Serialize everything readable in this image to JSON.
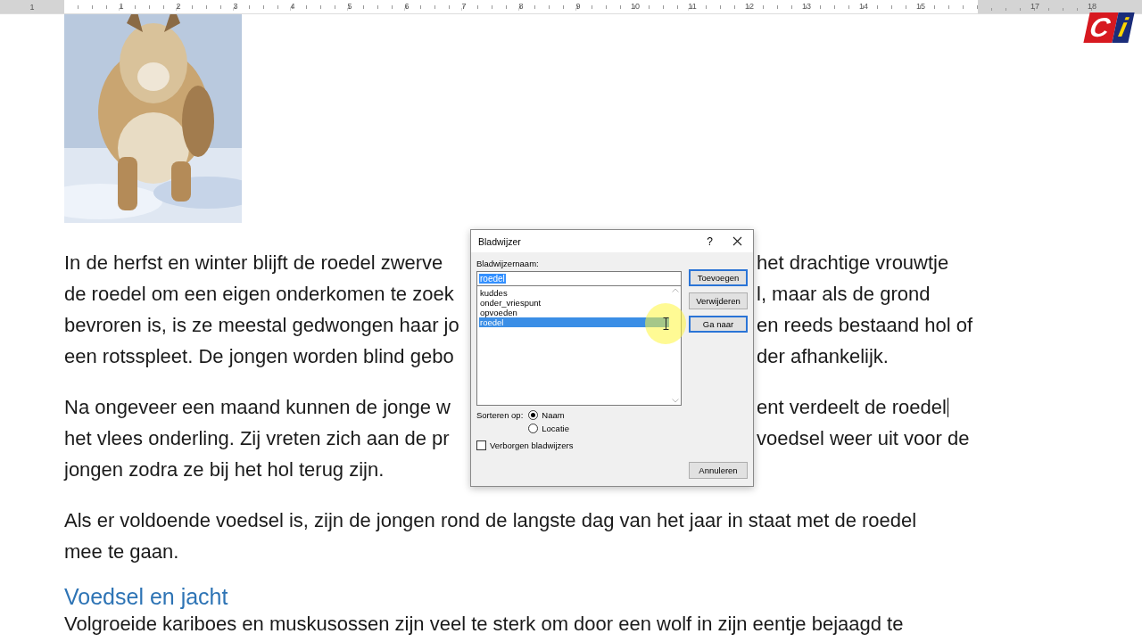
{
  "ruler": {
    "left_labels": [
      "1"
    ],
    "labels": [
      "1",
      "2",
      "3",
      "4",
      "5",
      "6",
      "7",
      "8",
      "9",
      "10",
      "11",
      "12",
      "13",
      "14",
      "15"
    ],
    "right_labels": [
      "17",
      "18"
    ]
  },
  "logo": {
    "letters": [
      "C",
      "i"
    ]
  },
  "paragraphs": [
    {
      "lines": [
        {
          "left": "In de herfst en winter blijft de roedel zwerve",
          "right": "het drachtige vrouwtje"
        },
        {
          "left": "de roedel om een eigen onderkomen te zoek",
          "right": "l, maar als de grond"
        },
        {
          "left": "bevroren is, is ze meestal gedwongen haar jo",
          "right": "en reeds bestaand hol of"
        },
        {
          "left": "een rotsspleet. De jongen worden blind gebo",
          "right": "der afhankelijk."
        }
      ]
    },
    {
      "lines": [
        {
          "left": "Na ongeveer een maand kunnen de jonge w",
          "right": "ent verdeelt de roedel",
          "caret": true
        },
        {
          "left": "het vlees onderling. Zij vreten zich aan de pr",
          "right": "voedsel weer uit voor de"
        },
        {
          "left": "jongen zodra ze bij het hol terug zijn."
        }
      ]
    },
    {
      "lines": [
        {
          "left": "Als er voldoende voedsel is, zijn de jongen rond de langste dag van het jaar in staat met de roedel"
        },
        {
          "left": "mee te gaan."
        }
      ]
    }
  ],
  "heading": "Voedsel en jacht",
  "last_line": "Volgroeide kariboes en muskusossen zijn veel te sterk om door een wolf in zijn eentje bejaagd te",
  "dialog": {
    "title": "Bladwijzer",
    "help": "?",
    "name_label": "Bladwijzernaam:",
    "name_value": "roedel",
    "items": [
      {
        "label": "kuddes",
        "selected": false
      },
      {
        "label": "onder_vriespunt",
        "selected": false
      },
      {
        "label": "opvoeden",
        "selected": false
      },
      {
        "label": "roedel",
        "selected": true
      }
    ],
    "buttons": [
      {
        "label": "Toevoegen",
        "focused": true
      },
      {
        "label": "Verwijderen",
        "focused": false
      },
      {
        "label": "Ga naar",
        "focused": true
      }
    ],
    "sort_label": "Sorteren op:",
    "sort_options": [
      {
        "label": "Naam",
        "selected": true
      },
      {
        "label": "Locatie",
        "selected": false
      }
    ],
    "hidden": {
      "label": "Verborgen bladwijzers",
      "checked": false
    },
    "cancel": "Annuleren"
  }
}
